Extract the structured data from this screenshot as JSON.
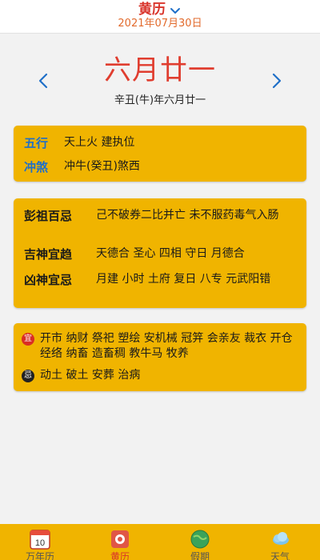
{
  "header": {
    "title": "黄历",
    "date": "2021年07月30日"
  },
  "lunar": {
    "big": "六月廿一",
    "sub": "辛丑(牛)年六月廿一"
  },
  "card1": {
    "wuxing_label": "五行",
    "wuxing_value": "天上火 建执位",
    "chongsha_label": "冲煞",
    "chongsha_value": "冲牛(癸丑)煞西"
  },
  "card2": {
    "pengzu_label": "彭祖百忌",
    "pengzu_value": "己不破券二比并亡 未不服药毒气入肠",
    "jishen_label": "吉神宜趋",
    "jishen_value": "天德合 圣心 四相 守日 月德合",
    "xiongshen_label": "凶神宜忌",
    "xiongshen_value": "月建 小时 土府 复日 八专 元武阳错"
  },
  "card3": {
    "yi_badge": "宜",
    "yi_value": "开市 纳财 祭祀 塑绘 安机械 冠笄 会亲友 裁衣 开仓 经络 纳畜 造畜稠 教牛马 牧养",
    "ji_badge": "忌",
    "ji_value": "动土 破土 安葬 治病"
  },
  "tabs": [
    {
      "label": "万年历",
      "icon_day": "10"
    },
    {
      "label": "黄历"
    },
    {
      "label": "假期"
    },
    {
      "label": "天气"
    }
  ],
  "colors": {
    "accent": "#f0b400",
    "red": "#d9342b",
    "blue": "#1f6fc8"
  }
}
